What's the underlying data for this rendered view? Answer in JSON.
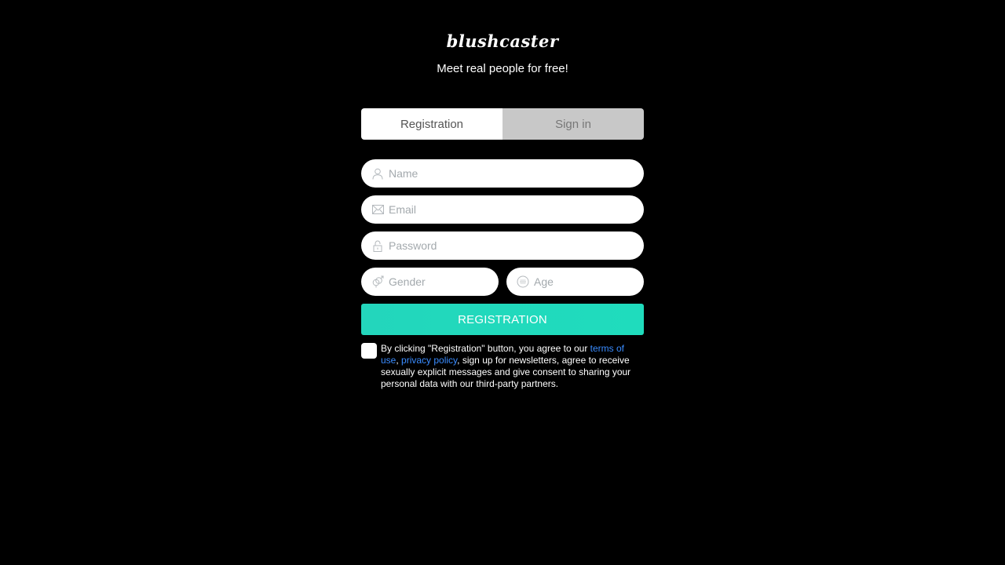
{
  "brand": {
    "logo": "blushcaster",
    "tagline": "Meet real people for free!"
  },
  "tabs": [
    {
      "label": "Registration",
      "active": true
    },
    {
      "label": "Sign in",
      "active": false
    }
  ],
  "form": {
    "name_placeholder": "Name",
    "email_placeholder": "Email",
    "password_placeholder": "Password",
    "gender_placeholder": "Gender",
    "age_placeholder": "Age",
    "submit_label": "REGISTRATION"
  },
  "consent": {
    "prefix": "By clicking \"Registration\" button, you agree to our ",
    "terms_link": "terms of use",
    "separator": ", ",
    "privacy_link": "privacy policy",
    "suffix": ", sign up for newsletters, agree to receive sexually explicit messages and give consent to sharing your personal data with our third-party partners."
  },
  "colors": {
    "background": "#000000",
    "accent": "#1fdcbd",
    "link": "#3a8cff",
    "placeholder": "#a3a9ad"
  }
}
